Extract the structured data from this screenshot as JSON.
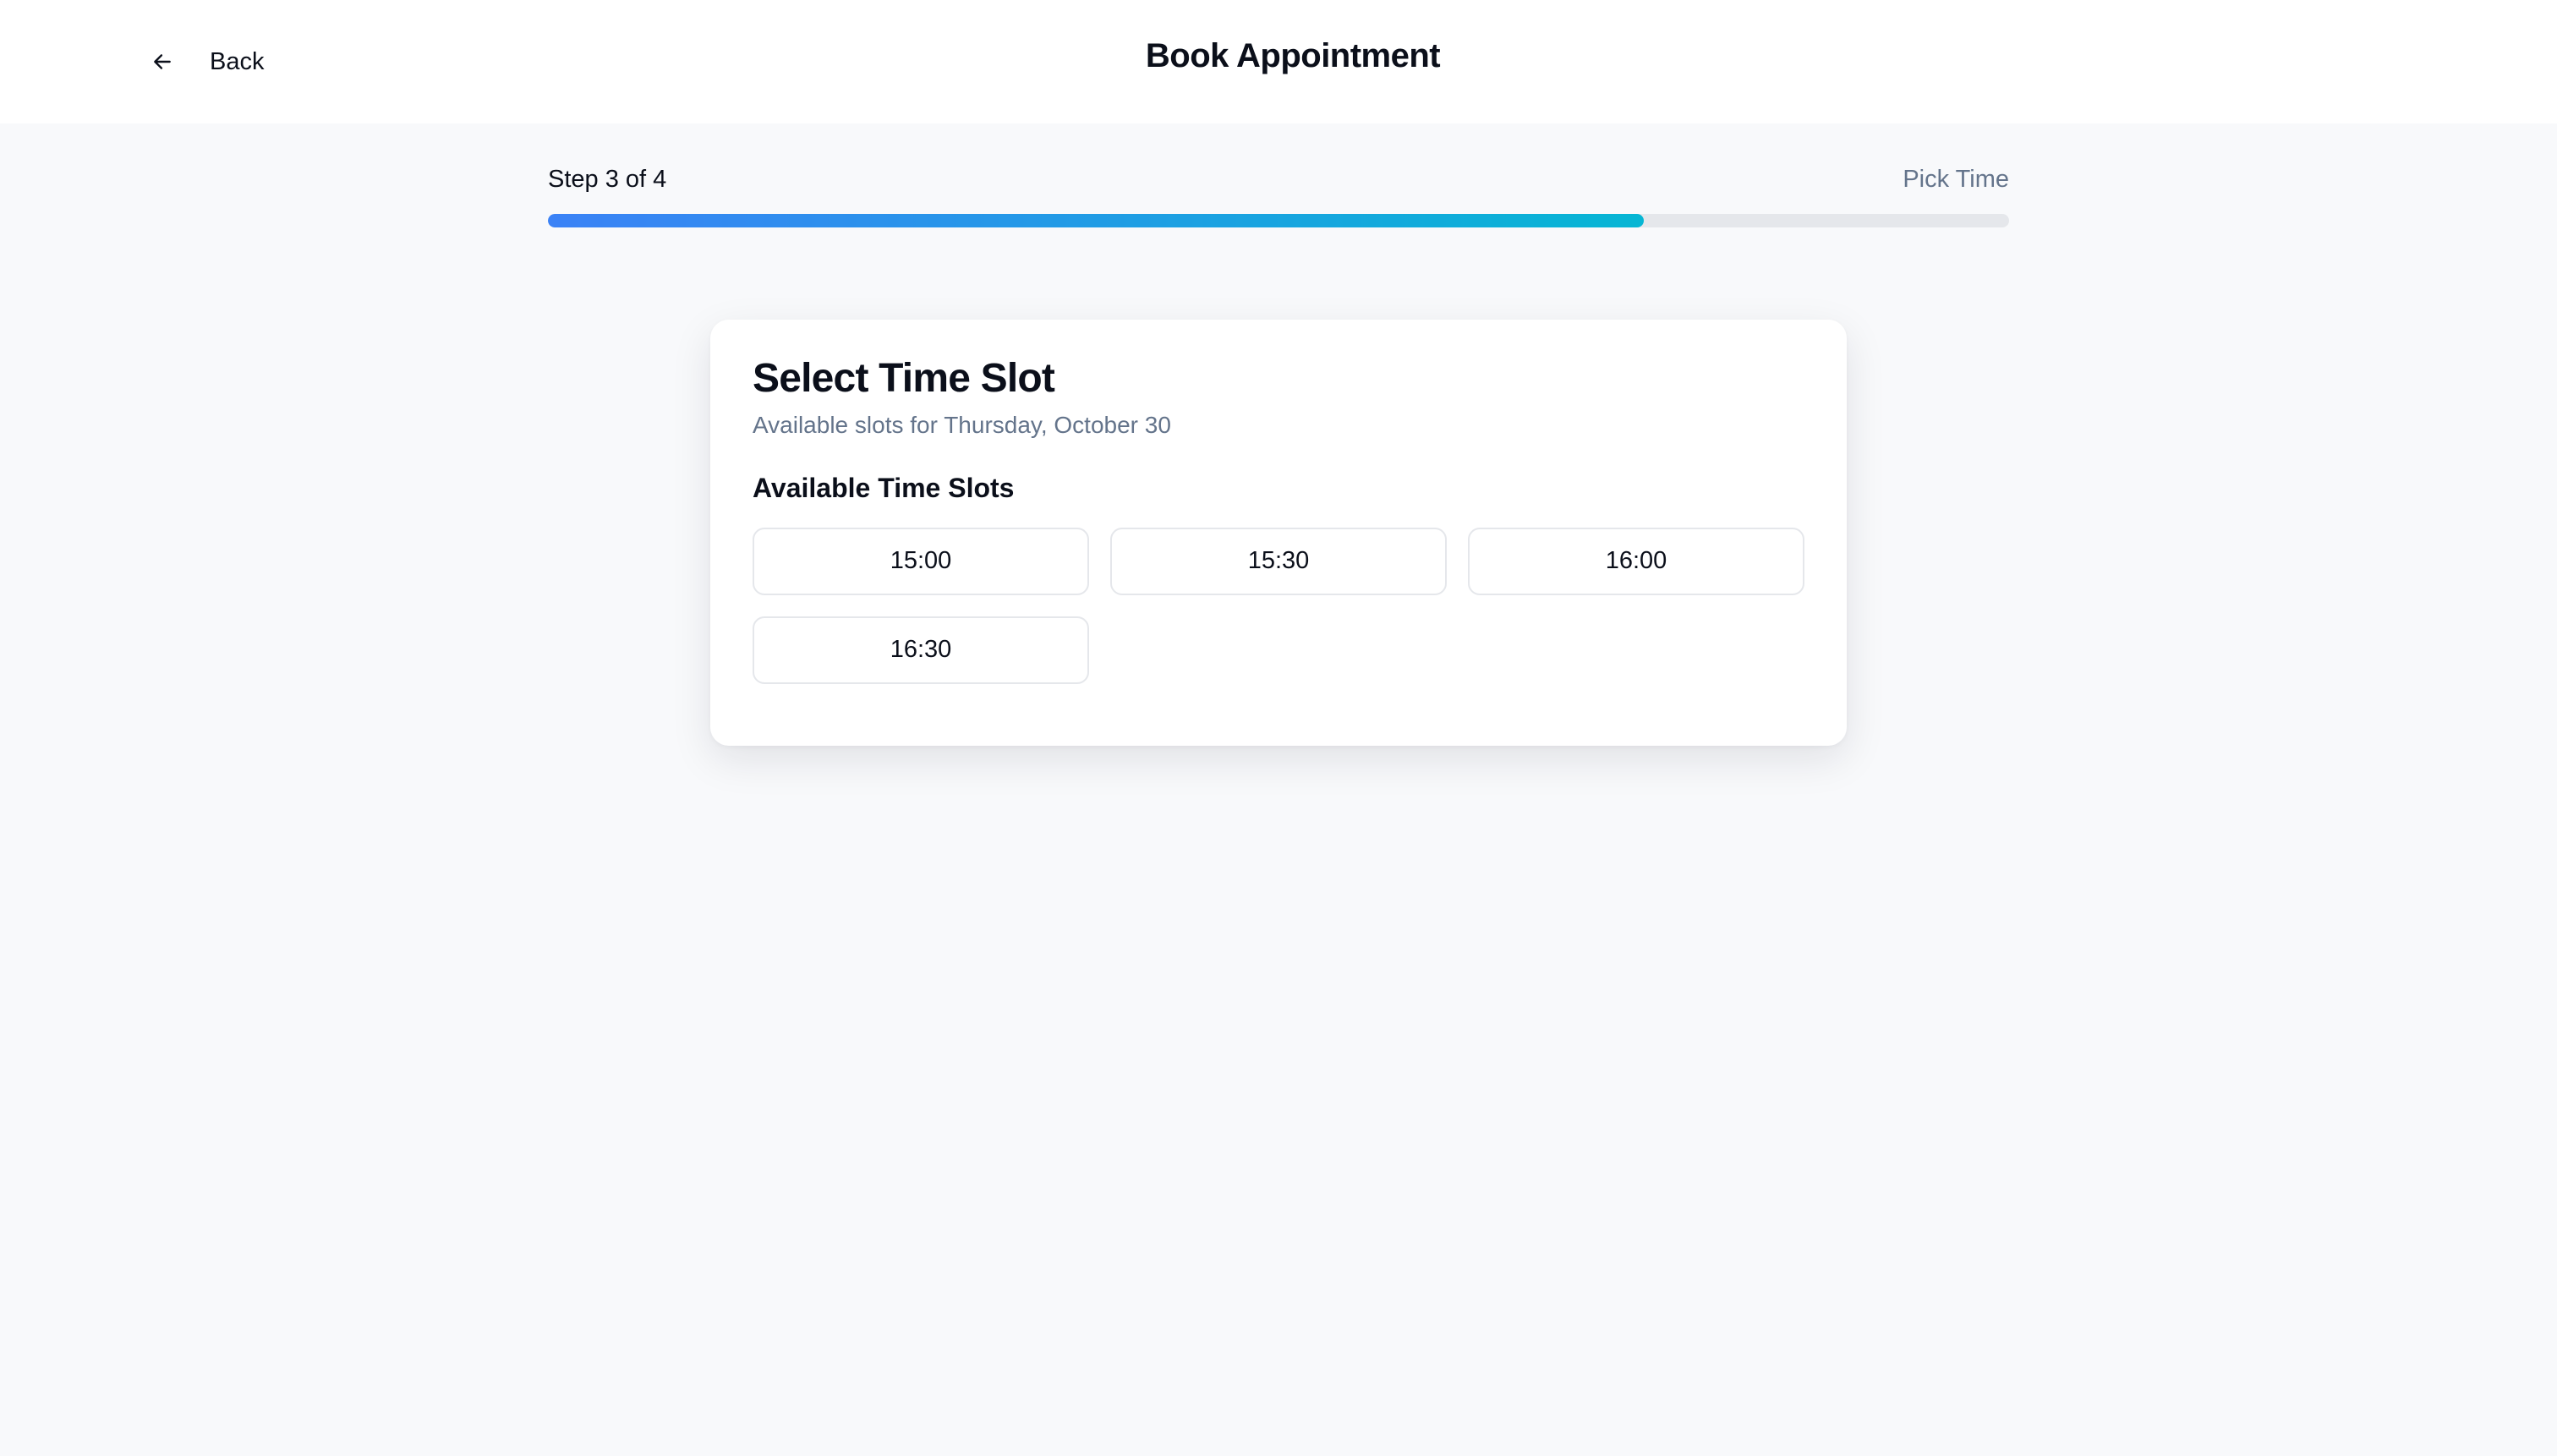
{
  "header": {
    "back_label": "Back",
    "title": "Book Appointment"
  },
  "progress": {
    "step_text": "Step 3 of 4",
    "step_name": "Pick Time",
    "current_step": 3,
    "total_steps": 4,
    "fill_percent": 75
  },
  "card": {
    "title": "Select Time Slot",
    "subtitle": "Available slots for Thursday, October 30",
    "section_title": "Available Time Slots",
    "slots": [
      {
        "label": "15:00"
      },
      {
        "label": "15:30"
      },
      {
        "label": "16:00"
      },
      {
        "label": "16:30"
      }
    ]
  },
  "icons": {
    "back": "arrow-left-icon"
  },
  "colors": {
    "accent_start": "#3b82f6",
    "accent_end": "#06b6d4",
    "track": "#e5e7eb",
    "muted_text": "#64748b"
  }
}
